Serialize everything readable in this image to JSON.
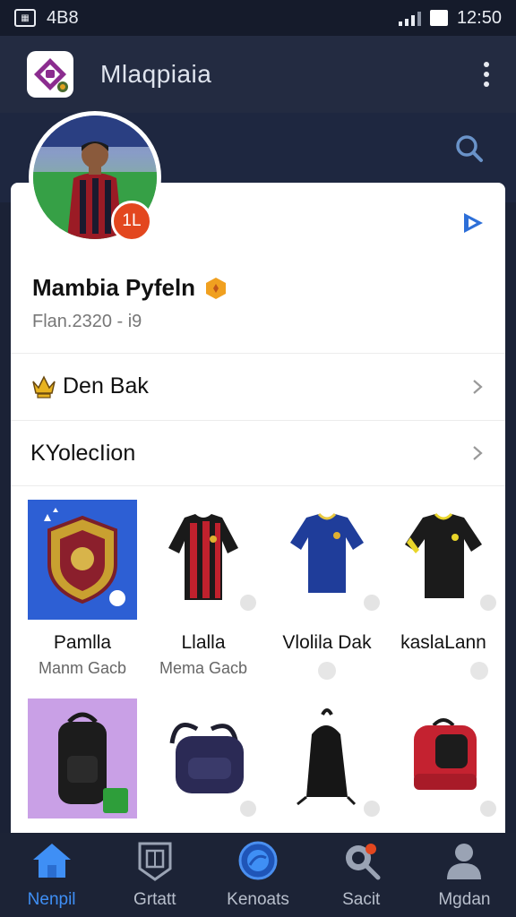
{
  "status_bar": {
    "left_text": "4B8",
    "time": "12:50"
  },
  "app_bar": {
    "title": "Mlaqpiaia"
  },
  "profile": {
    "name": "Mambia Pyfeln",
    "subtitle": "Flan.2320  -  i9",
    "badge": "1L"
  },
  "rows": [
    {
      "label": "Den Bak"
    },
    {
      "label": "KYolecIion"
    }
  ],
  "collection": [
    {
      "title": "Pamlla",
      "subtitle": "Manm Gacb"
    },
    {
      "title": "Llalla",
      "subtitle": "Mema Gacb"
    },
    {
      "title": "Vlolila Dak",
      "subtitle": ""
    },
    {
      "title": "kaslaLann",
      "subtitle": ""
    }
  ],
  "bottom_nav": [
    {
      "label": "Nenpil",
      "active": true
    },
    {
      "label": "Grtatt"
    },
    {
      "label": "Kenoats"
    },
    {
      "label": "Sacit"
    },
    {
      "label": "Mgdan"
    }
  ],
  "colors": {
    "accent": "#3f8ff5",
    "badge": "#e3471f",
    "app_bar": "#232b41",
    "nav_bg": "#1c2336"
  }
}
